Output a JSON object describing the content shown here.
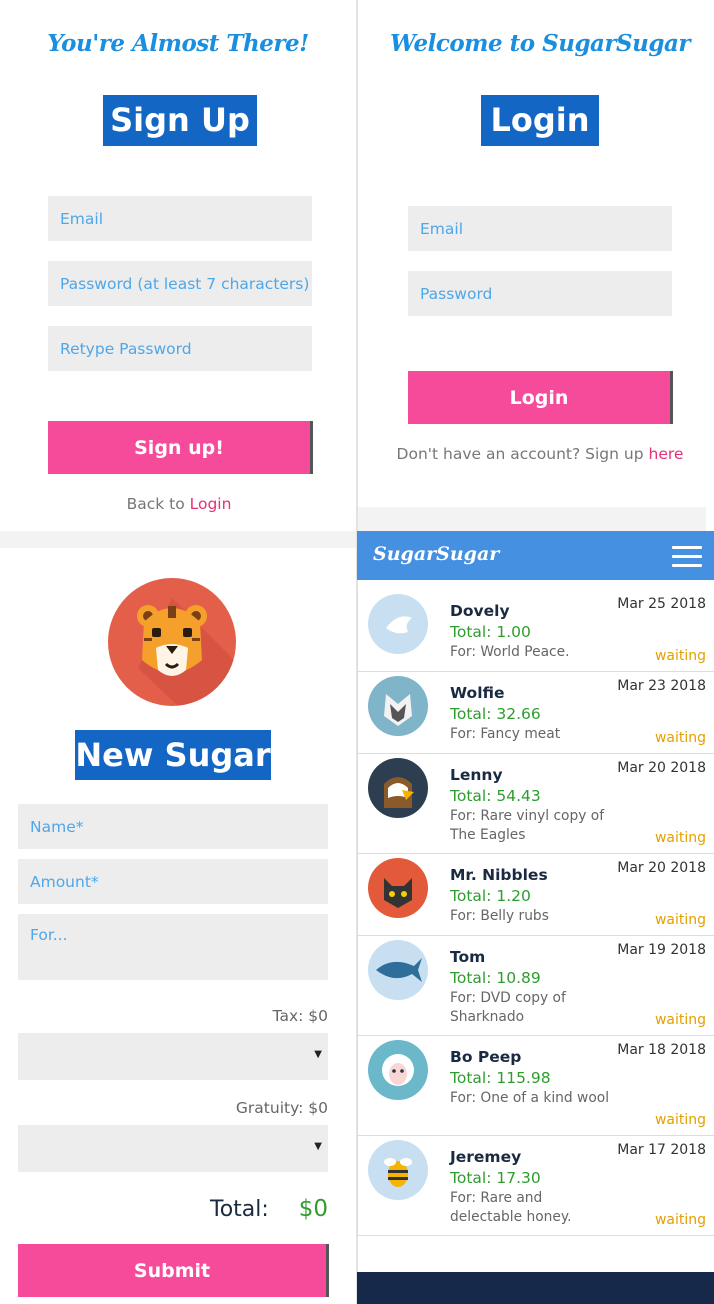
{
  "signup": {
    "title": "You're Almost There!",
    "heading": "Sign Up",
    "email_placeholder": "Email",
    "password_placeholder": "Password (at least 7 characters)",
    "retype_placeholder": "Retype Password",
    "submit_label": "Sign up!",
    "back_text": "Back to ",
    "back_link": "Login"
  },
  "login": {
    "title": "Welcome to SugarSugar",
    "heading": "Login",
    "email_placeholder": "Email",
    "password_placeholder": "Password",
    "submit_label": "Login",
    "signup_text": "Don't have an account? Sign up ",
    "signup_link": "here"
  },
  "new_sugar": {
    "heading": "New Sugar",
    "avatar_icon": "tiger-icon",
    "name_placeholder": "Name*",
    "amount_placeholder": "Amount*",
    "for_placeholder": "For...",
    "tax_label": "Tax: $0",
    "gratuity_label": "Gratuity: $0",
    "total_label": "Total:",
    "total_value": "$0",
    "submit_label": "Submit"
  },
  "app": {
    "brand": "SugarSugar",
    "menu_icon": "hamburger-menu-icon"
  },
  "sugars": [
    {
      "name": "Dovely",
      "total": "Total: 1.00",
      "for": "For: World Peace.",
      "date": "Mar 25 2018",
      "status": "waiting",
      "icon": "dove-icon"
    },
    {
      "name": "Wolfie",
      "total": "Total: 32.66",
      "for": "For: Fancy meat",
      "date": "Mar 23 2018",
      "status": "waiting",
      "icon": "wolf-icon"
    },
    {
      "name": "Lenny",
      "total": "Total: 54.43",
      "for": "For: Rare vinyl copy of The Eagles",
      "date": "Mar 20 2018",
      "status": "waiting",
      "icon": "eagle-icon"
    },
    {
      "name": "Mr. Nibbles",
      "total": "Total: 1.20",
      "for": "For: Belly rubs",
      "date": "Mar 20 2018",
      "status": "waiting",
      "icon": "cat-icon"
    },
    {
      "name": "Tom",
      "total": "Total: 10.89",
      "for": "For: DVD copy of Sharknado",
      "date": "Mar 19 2018",
      "status": "waiting",
      "icon": "shark-icon"
    },
    {
      "name": "Bo Peep",
      "total": "Total: 115.98",
      "for": "For: One of a kind wool",
      "date": "Mar 18 2018",
      "status": "waiting",
      "icon": "sheep-icon"
    },
    {
      "name": "Jeremey",
      "total": "Total: 17.30",
      "for": "For: Rare and delectable honey.",
      "date": "Mar 17 2018",
      "status": "waiting",
      "icon": "bee-icon"
    }
  ],
  "colors": {
    "accent_blue": "#1466c4",
    "pink": "#f54b9a",
    "green_total": "#2e9d2e",
    "status_waiting": "#e3a000",
    "navbar": "#4590e0"
  }
}
